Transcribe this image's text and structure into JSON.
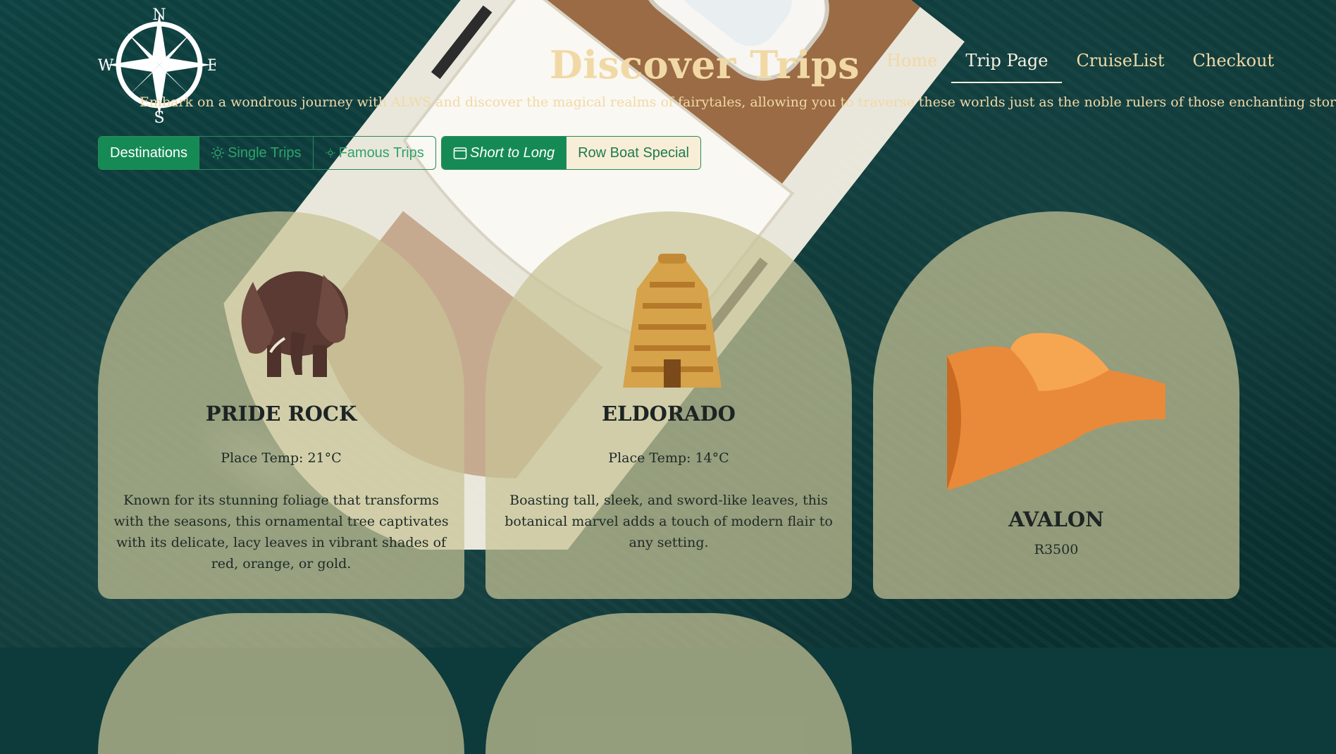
{
  "header": {
    "logo": {
      "icon": "compass-rose-icon",
      "north": "N",
      "south": "S",
      "east": "E",
      "west": "W"
    },
    "title": "Discover Trips",
    "tagline": "Embark on a wondrous journey with ALWS and discover the magical realms of fairytales, allowing you to traverse these worlds just as the noble rulers of those enchanting stories.\""
  },
  "nav": {
    "items": [
      {
        "label": "Home",
        "active": false
      },
      {
        "label": "Trip Page",
        "active": true
      },
      {
        "label": "CruiseList",
        "active": false
      },
      {
        "label": "Checkout",
        "active": false
      }
    ]
  },
  "filters": {
    "group1": [
      {
        "label": "Destinations",
        "icon": "",
        "active": true
      },
      {
        "label": "Single Trips",
        "icon": "sun-icon",
        "active": false
      },
      {
        "label": "Famous Trips",
        "icon": "sun-small-icon",
        "active": false
      }
    ],
    "group2": [
      {
        "label": "Short to Long",
        "icon": "calendar-icon",
        "active": true
      },
      {
        "label": "Row Boat Special",
        "icon": "",
        "active": false
      }
    ]
  },
  "cards": [
    {
      "title": "PRIDE ROCK",
      "image": "elephant",
      "temp": "Place Temp: 21°C",
      "description": "Known for its stunning foliage that transforms with the seasons, this ornamental tree captivates with its delicate, lacy leaves in vibrant shades of red, orange, or gold."
    },
    {
      "title": "ELDORADO",
      "image": "golden-temple",
      "temp": "Place Temp: 14°C",
      "description": "Boasting tall, sleek, and sword-like leaves, this botanical marvel adds a touch of modern flair to any setting."
    },
    {
      "title": "AVALON",
      "image": "orange-dune",
      "price": "R3500"
    }
  ],
  "colors": {
    "accent": "#168a55",
    "title": "#f1d9a6",
    "card": "#c8c396"
  }
}
